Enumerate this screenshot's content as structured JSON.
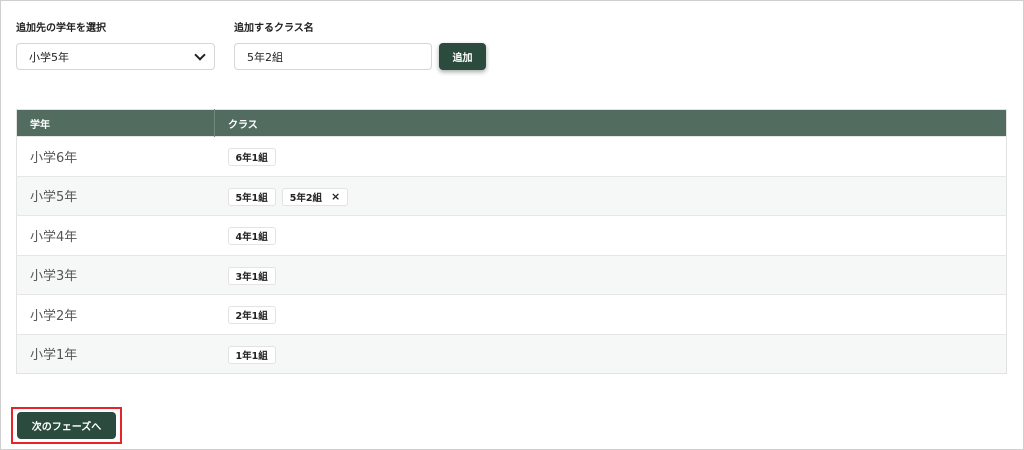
{
  "form": {
    "grade_label": "追加先の学年を選択",
    "grade_selected": "小学5年",
    "class_label": "追加するクラス名",
    "class_value": "5年2組",
    "add_label": "追加"
  },
  "table": {
    "headers": [
      "学年",
      "クラス"
    ],
    "rows": [
      {
        "grade": "小学6年",
        "classes": [
          {
            "name": "6年1組",
            "removable": false
          }
        ]
      },
      {
        "grade": "小学5年",
        "classes": [
          {
            "name": "5年1組",
            "removable": false
          },
          {
            "name": "5年2組",
            "removable": true
          }
        ]
      },
      {
        "grade": "小学4年",
        "classes": [
          {
            "name": "4年1組",
            "removable": false
          }
        ]
      },
      {
        "grade": "小学3年",
        "classes": [
          {
            "name": "3年1組",
            "removable": false
          }
        ]
      },
      {
        "grade": "小学2年",
        "classes": [
          {
            "name": "2年1組",
            "removable": false
          }
        ]
      },
      {
        "grade": "小学1年",
        "classes": [
          {
            "name": "1年1組",
            "removable": false
          }
        ]
      }
    ]
  },
  "remove_glyph": "×",
  "next_label": "次のフェーズへ",
  "colors": {
    "primary": "#2b4b3e",
    "table_header": "#526d60",
    "highlight": "#e8242a"
  },
  "icons": {
    "select_arrow": "chevron-down-icon",
    "remove": "close-icon"
  }
}
